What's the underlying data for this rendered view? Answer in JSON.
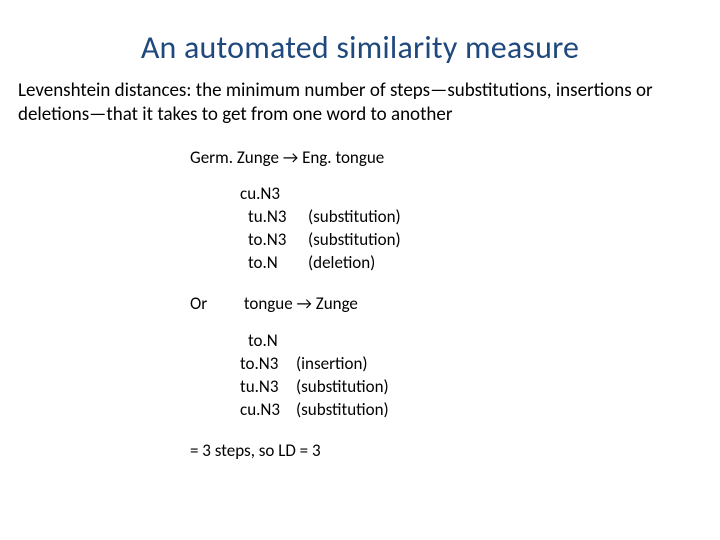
{
  "title": "An automated similarity measure",
  "body": "Levenshtein distances: the minimum number of steps—substitutions, insertions or deletions—that it takes to get from one word to another",
  "example": {
    "header_from_lang": "Germ.",
    "header_from_word": "Zunge",
    "arrow": "→",
    "header_to_lang": "Eng.",
    "header_to_word": "tongue",
    "steps_a": [
      {
        "word": "cu.N3",
        "op": ""
      },
      {
        "word": "tu.N3",
        "op": "(substitution)"
      },
      {
        "word": "to.N3",
        "op": "(substitution)"
      },
      {
        "word": "to.N",
        "op": "(deletion)"
      }
    ],
    "or_label": "Or",
    "reverse_from": "tongue",
    "reverse_to": "Zunge",
    "steps_b": [
      {
        "word": "to.N",
        "op": ""
      },
      {
        "word": "to.N3",
        "op": "(insertion)"
      },
      {
        "word": "tu.N3",
        "op": "(substitution)"
      },
      {
        "word": "cu.N3",
        "op": "(substitution)"
      }
    ],
    "conclusion": "= 3 steps, so LD = 3"
  }
}
